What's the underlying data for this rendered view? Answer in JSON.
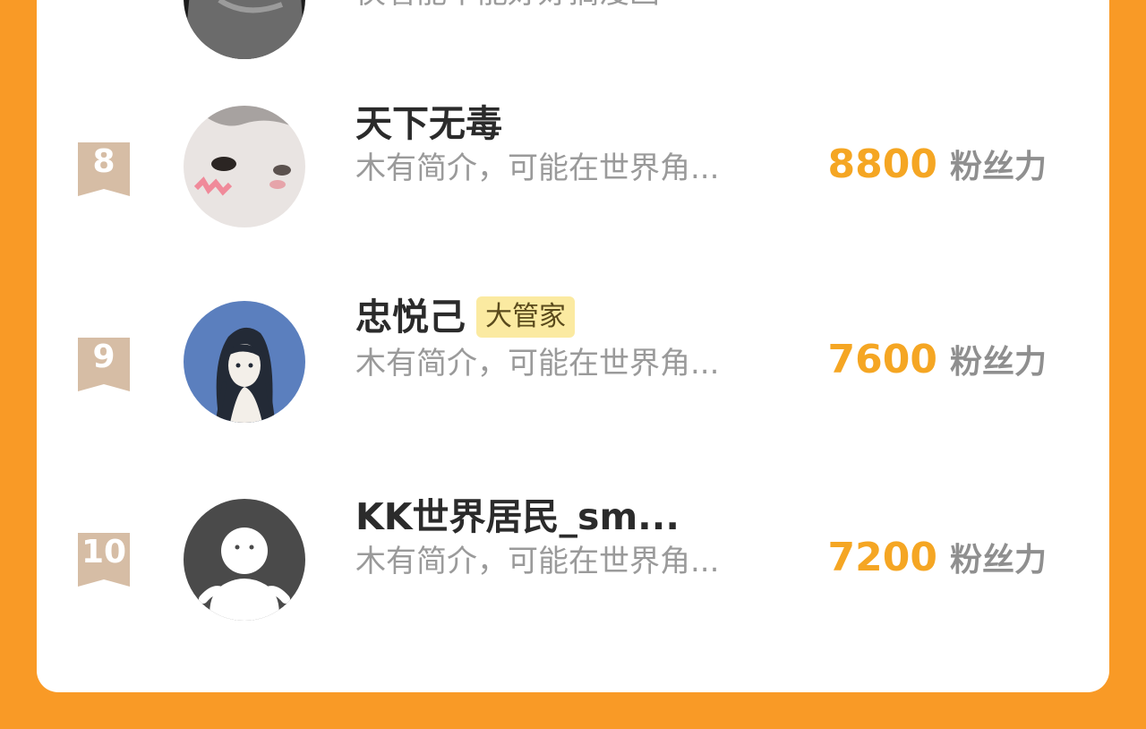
{
  "colors": {
    "page_background": "#f99a26",
    "card_background": "#ffffff",
    "rank_badge": "#d6bda5",
    "fans_number": "#f5a623",
    "fans_unit": "#8f8f8f",
    "tag_background": "#fbeaa1"
  },
  "partial_top_item": {
    "bio": "侠看能不能好好搞漫画",
    "avatar": "cat-avatar-dark"
  },
  "items": [
    {
      "rank": "8",
      "name": "天下无毒",
      "tag": "",
      "bio": "木有简介，可能在世界角...",
      "fans": "8800",
      "fans_unit": "粉丝力",
      "avatar": "white-cat-avatar"
    },
    {
      "rank": "9",
      "name": "忠悦己",
      "tag": "大管家",
      "bio": "木有简介，可能在世界角...",
      "fans": "7600",
      "fans_unit": "粉丝力",
      "avatar": "girl-illustration-avatar"
    },
    {
      "rank": "10",
      "name": "KK世界居民_sm...",
      "tag": "",
      "bio": "木有简介，可能在世界角...",
      "fans": "7200",
      "fans_unit": "粉丝力",
      "avatar": "default-person-avatar"
    }
  ]
}
